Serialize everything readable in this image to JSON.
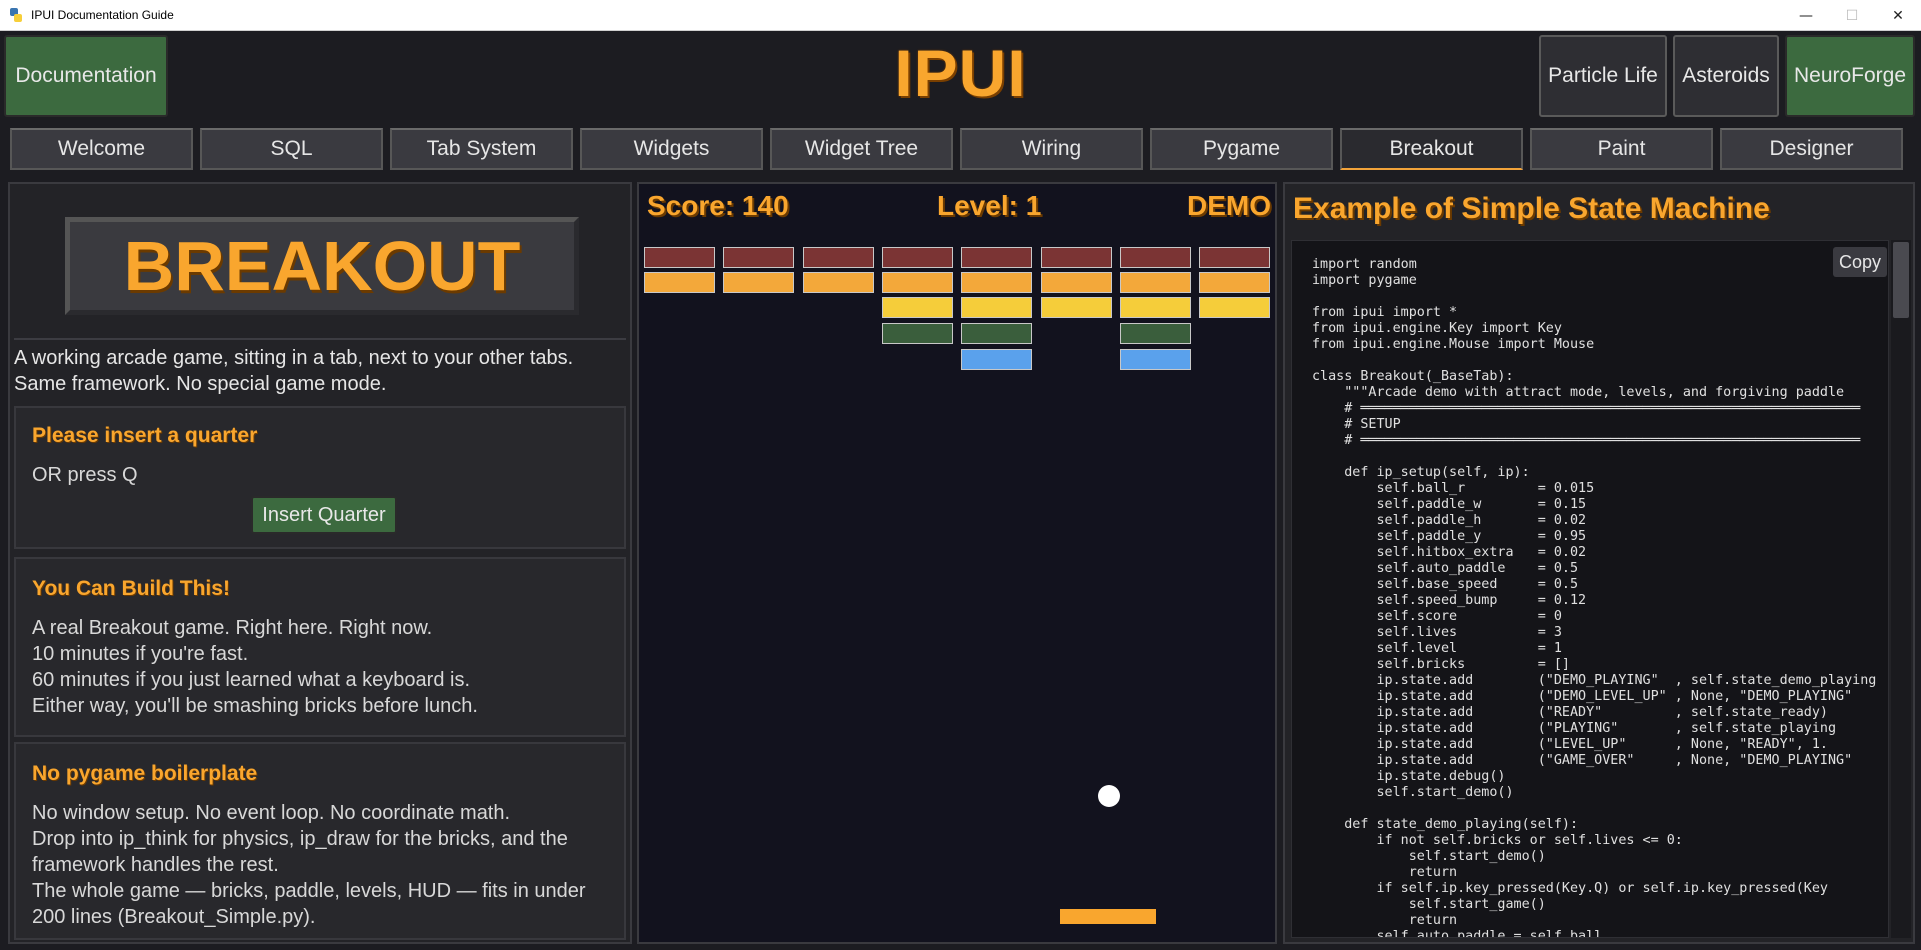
{
  "window": {
    "title": "IPUI Documentation Guide"
  },
  "header": {
    "title": "IPUI",
    "left_button": "Documentation",
    "right_buttons": [
      "Particle Life",
      "Asteroids",
      "NeuroForge"
    ]
  },
  "tabs": [
    "Welcome",
    "SQL",
    "Tab System",
    "Widgets",
    "Widget Tree",
    "Wiring",
    "Pygame",
    "Breakout",
    "Paint",
    "Designer"
  ],
  "active_tab": "Breakout",
  "left": {
    "logo_text": "BREAKOUT",
    "intro_line1": "A working arcade game, sitting in a tab, next to your other tabs.",
    "intro_line2": "Same framework. No special game mode.",
    "quarter": {
      "heading": "Please insert a quarter",
      "hint": "OR press Q",
      "button": "Insert Quarter"
    },
    "build": {
      "heading": "You Can Build This!",
      "lines": [
        "A real Breakout game. Right here. Right now.",
        "10 minutes if you're fast.",
        "60 minutes if you just learned what a keyboard is.",
        "Either way, you'll be smashing bricks before lunch."
      ]
    },
    "boilerplate": {
      "heading": "No pygame boilerplate",
      "lines": [
        "No window setup. No event loop. No coordinate math.",
        "Drop into ip_think for physics, ip_draw for the bricks, and the",
        "framework handles the rest.",
        "The whole game — bricks, paddle, levels, HUD — fits in under",
        "200 lines (Breakout_Simple.py)."
      ]
    }
  },
  "game": {
    "score": "Score: 140",
    "level": "Level: 1",
    "mode": "DEMO",
    "colors": {
      "row1": "#7b3434",
      "row2": "#f3a83a",
      "row3": "#f5cd3a",
      "row4": "#3a5e3c",
      "row5": "#5aa1ec"
    },
    "brick_rows": [
      [
        1,
        1,
        1,
        1,
        1,
        1,
        1,
        1
      ],
      [
        1,
        1,
        1,
        1,
        1,
        1,
        1,
        1
      ],
      [
        0,
        0,
        0,
        1,
        1,
        1,
        1,
        1
      ],
      [
        0,
        0,
        0,
        1,
        1,
        0,
        1,
        0
      ],
      [
        0,
        0,
        0,
        0,
        1,
        0,
        1,
        0
      ]
    ]
  },
  "code": {
    "title": "Example of Simple State Machine",
    "copy_label": "Copy",
    "text": "import random\nimport pygame\n\nfrom ipui import *\nfrom ipui.engine.Key import Key\nfrom ipui.engine.Mouse import Mouse\n\nclass Breakout(_BaseTab):\n    \"\"\"Arcade demo with attract mode, levels, and forgiving paddle\n    # ══════════════════════════════════════════════════════════════\n    # SETUP\n    # ══════════════════════════════════════════════════════════════\n\n    def ip_setup(self, ip):\n        self.ball_r         = 0.015\n        self.paddle_w       = 0.15\n        self.paddle_h       = 0.02\n        self.paddle_y       = 0.95\n        self.hitbox_extra   = 0.02\n        self.auto_paddle    = 0.5\n        self.base_speed     = 0.5\n        self.speed_bump     = 0.12\n        self.score          = 0\n        self.lives          = 3\n        self.level          = 1\n        self.bricks         = []\n        ip.state.add        (\"DEMO_PLAYING\"  , self.state_demo_playing\n        ip.state.add        (\"DEMO_LEVEL_UP\" , None, \"DEMO_PLAYING\"\n        ip.state.add        (\"READY\"         , self.state_ready)\n        ip.state.add        (\"PLAYING\"       , self.state_playing\n        ip.state.add        (\"LEVEL_UP\"      , None, \"READY\", 1.\n        ip.state.add        (\"GAME_OVER\"     , None, \"DEMO_PLAYING\"\n        ip.state.debug()\n        self.start_demo()\n\n    def state_demo_playing(self):\n        if not self.bricks or self.lives <= 0:\n            self.start_demo()\n            return\n        if self.ip.key_pressed(Key.Q) or self.ip.key_pressed(Key\n            self.start_game()\n            return\n        self.auto_paddle = self.ball"
  }
}
